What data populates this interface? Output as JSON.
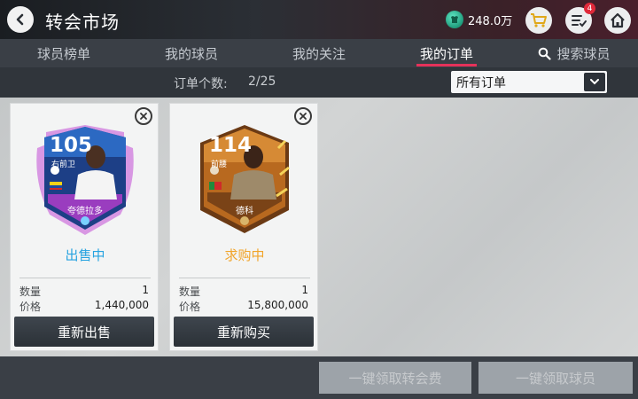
{
  "header": {
    "title": "转会市场",
    "coins": "248.0万",
    "notification_count": "4"
  },
  "tabs": [
    {
      "label": "球员榜单"
    },
    {
      "label": "我的球员"
    },
    {
      "label": "我的关注"
    },
    {
      "label": "我的订单",
      "active": true
    },
    {
      "label": "搜索球员"
    }
  ],
  "filter": {
    "order_count_label": "订单个数:",
    "order_count": "2/25",
    "select_value": "所有订单"
  },
  "orders": [
    {
      "rating": "105",
      "position": "右前卫",
      "player_name": "夸德拉多",
      "status": "出售中",
      "quantity_label": "数量",
      "quantity": "1",
      "price_label": "价格",
      "price": "1,440,000",
      "action": "重新出售"
    },
    {
      "rating": "114",
      "position": "前腰",
      "player_name": "德科",
      "status": "求购中",
      "quantity_label": "数量",
      "quantity": "1",
      "price_label": "价格",
      "price": "15,800,000",
      "action": "重新购买"
    }
  ],
  "bottom": {
    "claim_fees": "一键领取转会费",
    "claim_players": "一键领取球员"
  },
  "colors": {
    "accent_tab": "#e6325a",
    "selling_status": "#27a3e0",
    "buying_status": "#f1a42a",
    "coin": "#2fbf98"
  }
}
